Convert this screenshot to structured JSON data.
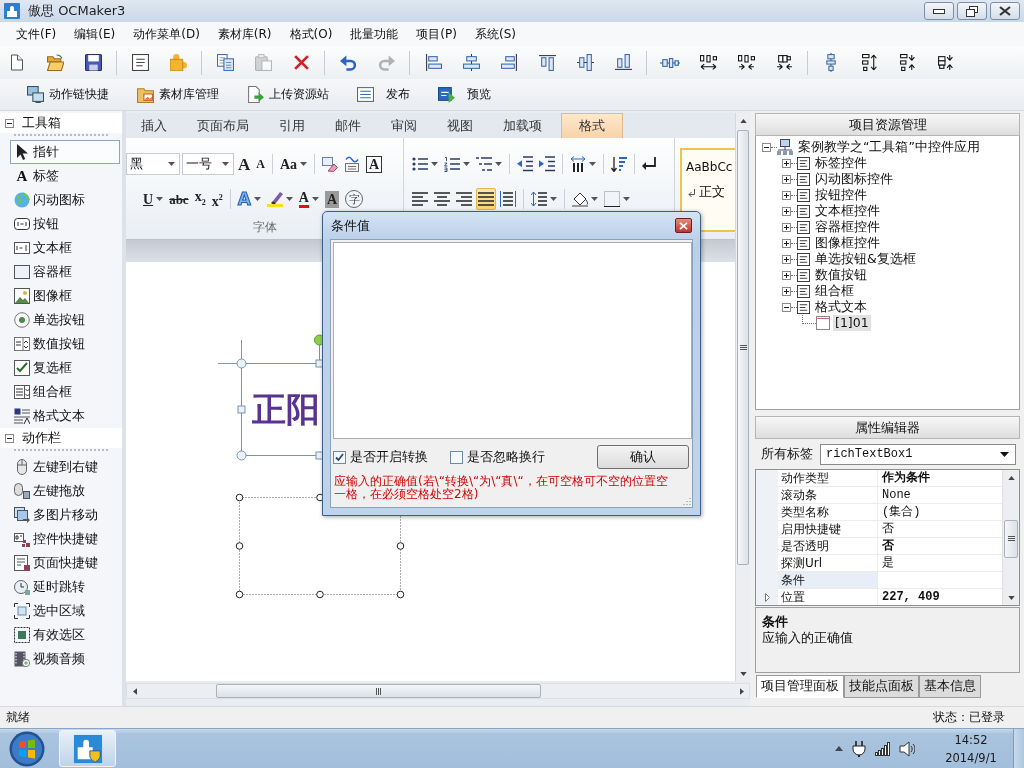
{
  "window": {
    "title": "傲思 OCMaker3"
  },
  "menu": [
    "文件(F)",
    "编辑(E)",
    "动作菜单(D)",
    "素材库(R)",
    "格式(O)",
    "批量功能",
    "项目(P)",
    "系统(S)"
  ],
  "toolbar": [
    [
      {
        "disabled": false
      },
      {
        "disabled": false
      },
      {
        "disabled": false
      }
    ],
    [
      {
        "disabled": false
      },
      {
        "disabled": false
      }
    ],
    [
      {
        "disabled": false
      },
      {
        "disabled": true
      },
      {
        "disabled": false
      }
    ],
    [
      {
        "disabled": false
      },
      {
        "disabled": true
      }
    ],
    [
      {
        "disabled": false
      },
      {
        "disabled": false
      },
      {
        "disabled": false
      },
      {
        "disabled": false
      },
      {
        "disabled": false
      },
      {
        "disabled": false
      }
    ],
    [
      {
        "disabled": false
      },
      {
        "disabled": false
      },
      {
        "disabled": false
      },
      {
        "disabled": false
      }
    ],
    [
      {
        "disabled": false
      },
      {
        "disabled": false
      },
      {
        "disabled": false
      },
      {
        "disabled": false
      }
    ]
  ],
  "quick_bar": [
    "动作链快捷",
    "素材库管理",
    "上传资源站",
    "发布",
    "预览"
  ],
  "toolbox": [
    {
      "title": "工具箱",
      "expanded": true,
      "items": [
        {
          "label": "指针",
          "selected": true
        },
        {
          "label": "标签",
          "glyph": "A",
          "selected": false
        },
        {
          "label": "闪动图标",
          "selected": false
        },
        {
          "label": "按钮",
          "selected": false
        },
        {
          "label": "文本框",
          "selected": false
        },
        {
          "label": "容器框",
          "selected": false
        },
        {
          "label": "图像框",
          "selected": false
        },
        {
          "label": "单选按钮",
          "selected": false
        },
        {
          "label": "数值按钮",
          "selected": false
        },
        {
          "label": "复选框",
          "selected": false
        },
        {
          "label": "组合框",
          "selected": false
        },
        {
          "label": "格式文本",
          "selected": false
        }
      ]
    },
    {
      "title": "动作栏",
      "expanded": true,
      "items": [
        {
          "label": "左键到右键",
          "selected": false
        },
        {
          "label": "左键拖放",
          "selected": false
        },
        {
          "label": "多图片移动",
          "selected": false
        },
        {
          "label": "控件快捷键",
          "selected": false
        },
        {
          "label": "页面快捷键",
          "selected": false
        },
        {
          "label": "延时跳转",
          "selected": false
        },
        {
          "label": "选中区域",
          "selected": false
        },
        {
          "label": "有效选区",
          "selected": false
        },
        {
          "label": "视频音频",
          "selected": false
        }
      ]
    }
  ],
  "ribbon": {
    "tabs": [
      {
        "label": "插入",
        "selected": false
      },
      {
        "label": "页面布局",
        "selected": false
      },
      {
        "label": "引用",
        "selected": false
      },
      {
        "label": "邮件",
        "selected": false
      },
      {
        "label": "审阅",
        "selected": false
      },
      {
        "label": "视图",
        "selected": false
      },
      {
        "label": "加载项",
        "selected": false
      },
      {
        "label": "格式",
        "selected": true
      }
    ],
    "groups": [
      {
        "kind": "buttons",
        "label": "字体",
        "upper": [
          {
            "kind": "combo",
            "value": "黑"
          },
          {
            "kind": "combo",
            "value": "一号"
          },
          {
            "kind": "glyph",
            "glyph": "A"
          },
          {
            "kind": "glyph",
            "glyph": "A"
          },
          {
            "kind": "separator"
          },
          {
            "kind": "glyph",
            "glyph": "Aa",
            "dropdown": true
          },
          {
            "kind": "separator"
          },
          {
            "kind": "icon"
          },
          {
            "kind": "icon"
          },
          {
            "kind": "glyph",
            "glyph": "A"
          }
        ],
        "lower": [
          {
            "kind": "glyph",
            "glyph": "U",
            "dropdown": true
          },
          {
            "kind": "glyph",
            "glyph": "abc"
          },
          {
            "kind": "glyph",
            "glyph": "x$_{2}$"
          },
          {
            "kind": "glyph",
            "glyph": "x$^{2}$"
          },
          {
            "kind": "separator"
          },
          {
            "kind": "glyph",
            "glyph": "A",
            "dropdown": true
          },
          {
            "kind": "icon",
            "dropdown": true
          },
          {
            "kind": "glyph",
            "glyph": "A",
            "dropdown": true
          },
          {
            "kind": "glyph",
            "glyph": "A"
          },
          {
            "kind": "glyph",
            "glyph": "字"
          }
        ]
      },
      {
        "kind": "buttons",
        "upper": [
          {
            "kind": "icon",
            "dropdown": true
          },
          {
            "kind": "icon",
            "dropdown": true
          },
          {
            "kind": "icon",
            "dropdown": true
          },
          {
            "kind": "separator"
          },
          {
            "kind": "icon"
          },
          {
            "kind": "icon"
          },
          {
            "kind": "separator"
          },
          {
            "kind": "icon",
            "dropdown": true
          },
          {
            "kind": "separator"
          },
          {
            "kind": "icon"
          },
          {
            "kind": "separator"
          },
          {
            "kind": "icon"
          }
        ],
        "lower": [
          {
            "kind": "icon",
            "selected": false
          },
          {
            "kind": "icon",
            "selected": false
          },
          {
            "kind": "icon",
            "selected": false
          },
          {
            "kind": "icon",
            "selected": true
          },
          {
            "kind": "icon",
            "selected": false
          },
          {
            "kind": "separator"
          },
          {
            "kind": "icon",
            "dropdown": true
          },
          {
            "kind": "separator"
          },
          {
            "kind": "icon",
            "dropdown": true
          },
          {
            "kind": "icon",
            "dropdown": true
          }
        ]
      },
      {
        "kind": "styles",
        "styles": [
          {
            "sample": "AaBbCc",
            "name": "正文",
            "selected": true
          }
        ]
      }
    ]
  },
  "canvas": {
    "text": "正阳"
  },
  "dialog": {
    "title": "条件值",
    "options": [
      {
        "label": "是否开启转换",
        "checked": true
      },
      {
        "label": "是否忽略换行",
        "checked": false
      }
    ],
    "button": "确认",
    "hint": "应输入的正确值(若\\“转换\\“为\\“真\\“，在可空格可不空的位置空一格，在必须空格处空2格)"
  },
  "project_panel": {
    "title": "项目资源管理",
    "tree": [
      {
        "label": "案例教学之“工具箱”中控件应用",
        "expanded": true,
        "selected": false,
        "children": [
          {
            "label": "标签控件",
            "expanded": false,
            "selected": false
          },
          {
            "label": "闪动图标控件",
            "expanded": false,
            "selected": false
          },
          {
            "label": "按钮控件",
            "expanded": false,
            "selected": false
          },
          {
            "label": "文本框控件",
            "expanded": false,
            "selected": false
          },
          {
            "label": "容器框控件",
            "expanded": false,
            "selected": false
          },
          {
            "label": "图像框控件",
            "expanded": false,
            "selected": false
          },
          {
            "label": "单选按钮&复选框",
            "expanded": false,
            "selected": false
          },
          {
            "label": "数值按钮",
            "expanded": false,
            "selected": false
          },
          {
            "label": "组合框",
            "expanded": false,
            "selected": false
          },
          {
            "label": "格式文本",
            "expanded": true,
            "selected": false,
            "children": [
              {
                "label": "[1]01",
                "selected": true
              }
            ]
          }
        ]
      }
    ]
  },
  "property_panel": {
    "title": "属性编辑器",
    "filter_label": "所有标签",
    "filter_value": "richTextBox1",
    "rows": [
      {
        "name": "动作类型",
        "value": "作为条件",
        "modified": true,
        "expandable": false,
        "selected": false
      },
      {
        "name": "滚动条",
        "value": "None",
        "modified": false,
        "expandable": false,
        "selected": false
      },
      {
        "name": "类型名称",
        "value": "(集合)",
        "modified": false,
        "expandable": false,
        "selected": false
      },
      {
        "name": "启用快捷键",
        "value": "否",
        "modified": false,
        "expandable": false,
        "selected": false
      },
      {
        "name": "是否透明",
        "value": "否",
        "modified": true,
        "expandable": false,
        "selected": false
      },
      {
        "name": "探测Url",
        "value": "是",
        "modified": false,
        "expandable": false,
        "selected": false
      },
      {
        "name": "条件",
        "expandable": false,
        "selected": true
      },
      {
        "name": "位置",
        "value": "227, 409",
        "modified": true,
        "expandable": true,
        "selected": false
      }
    ],
    "description": {
      "title": "条件",
      "text": "应输入的正确值"
    }
  },
  "panel_tabs": [
    {
      "label": "项目管理面板",
      "selected": true
    },
    {
      "label": "技能点面板",
      "selected": false
    },
    {
      "label": "基本信息",
      "selected": false
    }
  ],
  "status_bar": {
    "left": "就绪",
    "right": "状态：已登录"
  },
  "taskbar": {
    "time": "14:52",
    "date": "2014/9/1"
  }
}
